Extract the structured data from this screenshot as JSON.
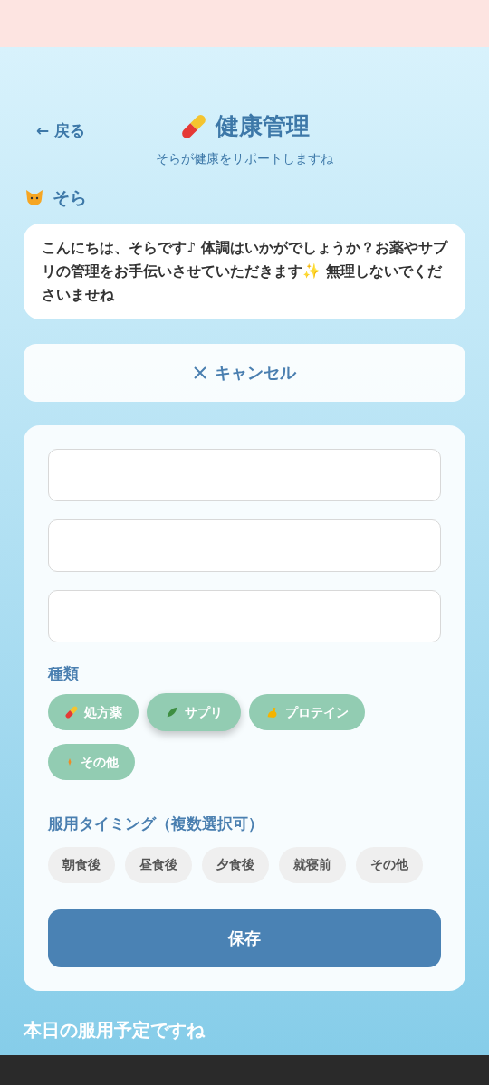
{
  "header": {
    "back": "← 戻る",
    "title": "健康管理",
    "subtitle": "そらが健康をサポートしますね"
  },
  "assistant": {
    "name": "そら",
    "message": "こんにちは、そらです♪ 体調はいかがでしょうか？お薬やサプリの管理をお手伝いさせていただきます✨ 無理しないでくださいませね"
  },
  "cancel_button": "キャンセル",
  "form": {
    "type_label": "種類",
    "types": [
      {
        "label": "処方薬",
        "kind": "pill",
        "selected": false
      },
      {
        "label": "サプリ",
        "kind": "leaf",
        "selected": true
      },
      {
        "label": "プロテイン",
        "kind": "arm",
        "selected": false
      },
      {
        "label": "その他",
        "kind": "dot",
        "selected": false
      }
    ],
    "timing_label": "服用タイミング（複数選択可）",
    "timings": [
      {
        "label": "朝食後",
        "selected": false
      },
      {
        "label": "昼食後",
        "selected": false
      },
      {
        "label": "夕食後",
        "selected": false
      },
      {
        "label": "就寝前",
        "selected": false
      },
      {
        "label": "その他",
        "selected": false
      }
    ],
    "save_button": "保存"
  },
  "schedule_heading": "本日の服用予定ですね"
}
